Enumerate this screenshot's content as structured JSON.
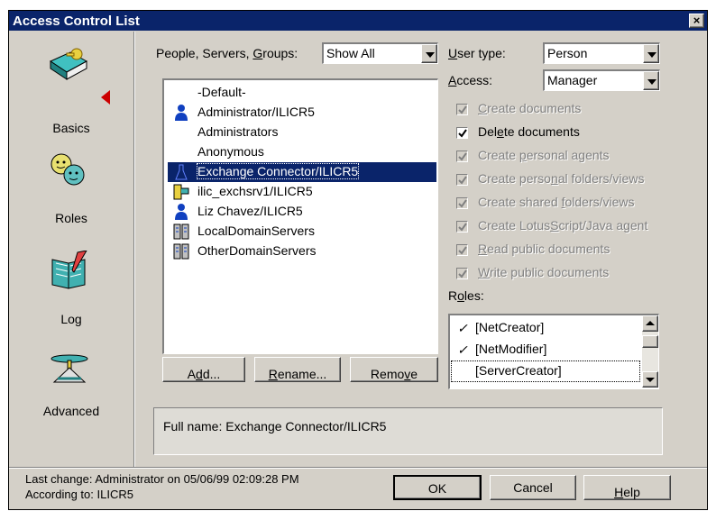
{
  "window": {
    "title": "Access Control List",
    "close_label": "×"
  },
  "sidebar": {
    "items": [
      {
        "label": "Basics",
        "icon": "book-key-icon",
        "selected": true
      },
      {
        "label": "Roles",
        "icon": "roles-faces-icon"
      },
      {
        "label": "Log",
        "icon": "log-book-icon"
      },
      {
        "label": "Advanced",
        "icon": "advanced-propeller-icon"
      }
    ]
  },
  "filter": {
    "label_pre": "People, Servers, ",
    "label_key": "G",
    "label_post": "roups:",
    "value": "Show All"
  },
  "entries": [
    {
      "name": "-Default-",
      "icon": "none"
    },
    {
      "name": "Administrator/ILICR5",
      "icon": "person-icon"
    },
    {
      "name": "Administrators",
      "icon": "none"
    },
    {
      "name": "Anonymous",
      "icon": "none"
    },
    {
      "name": "Exchange Connector/ILICR5",
      "icon": "flask-icon",
      "selected": true
    },
    {
      "name": "ilic_exchsrv1/ILICR5",
      "icon": "server-icon"
    },
    {
      "name": "Liz Chavez/ILICR5",
      "icon": "person-icon"
    },
    {
      "name": "LocalDomainServers",
      "icon": "server-group-icon"
    },
    {
      "name": "OtherDomainServers",
      "icon": "server-group-icon"
    }
  ],
  "user_type": {
    "label_key": "U",
    "label_rest": "ser type:",
    "value": "Person"
  },
  "access": {
    "label_pre": "",
    "label_key": "A",
    "label_rest": "ccess:",
    "value": "Manager"
  },
  "permissions": [
    {
      "pre": "",
      "key": "C",
      "post": "reate documents",
      "checked": true,
      "disabled": true
    },
    {
      "pre": "Del",
      "key": "e",
      "post": "te documents",
      "checked": true,
      "disabled": false
    },
    {
      "pre": "Create ",
      "key": "p",
      "post": "ersonal agents",
      "checked": true,
      "disabled": true
    },
    {
      "pre": "Create perso",
      "key": "n",
      "post": "al folders/views",
      "checked": true,
      "disabled": true
    },
    {
      "pre": "Create shared ",
      "key": "f",
      "post": "olders/views",
      "checked": true,
      "disabled": true
    },
    {
      "pre": "Create Lotus",
      "key": "S",
      "post": "cript/Java agent",
      "checked": true,
      "disabled": true
    },
    {
      "pre": "",
      "key": "R",
      "post": "ead public documents",
      "checked": true,
      "disabled": true
    },
    {
      "pre": "",
      "key": "W",
      "post": "rite public documents",
      "checked": true,
      "disabled": true
    }
  ],
  "roles": {
    "label_pre": "R",
    "label_key": "o",
    "label_post": "les:",
    "items": [
      {
        "name": "[NetCreator]",
        "checked": true
      },
      {
        "name": "[NetModifier]",
        "checked": true
      },
      {
        "name": "[ServerCreator]",
        "checked": false
      }
    ]
  },
  "buttons": {
    "add": {
      "pre": "A",
      "key": "d",
      "post": "d..."
    },
    "rename": {
      "pre": "",
      "key": "R",
      "post": "ename..."
    },
    "remove": {
      "pre": "Remo",
      "key": "v",
      "post": "e"
    },
    "ok": "OK",
    "cancel": "Cancel",
    "help": {
      "pre": "",
      "key": "H",
      "post": "elp"
    }
  },
  "full_name": "Full name: Exchange Connector/ILICR5",
  "status": {
    "last_change": "Last change: Administrator on 05/06/99 02:09:28 PM",
    "according_to": "According to: ILICR5"
  },
  "colors": {
    "title_bar": "#0a246a",
    "dialog_face": "#d4d0c8",
    "selection": "#0a246a",
    "indicator": "#cc0000"
  }
}
